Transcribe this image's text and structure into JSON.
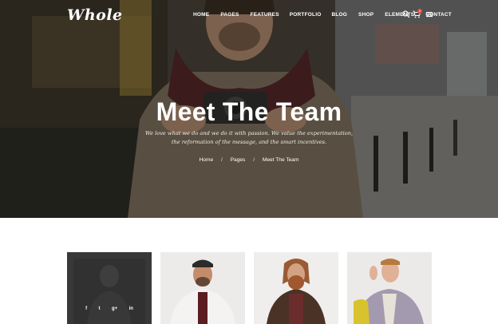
{
  "brand": {
    "logo_text": "Whole"
  },
  "nav": {
    "items": [
      "HOME",
      "PAGES",
      "FEATURES",
      "PORTFOLIO",
      "BLOG",
      "SHOP",
      "ELEMENTS",
      "CONTACT"
    ]
  },
  "header_icons": {
    "search": "search-icon",
    "cart": "cart-icon",
    "cart_count": "0",
    "menu": "hamburger-menu-icon"
  },
  "hero": {
    "title": "Meet The Team",
    "subtitle": "We love what we do and we do it with passion. We value the experimentation, the reformation of the message, and the smart incentives.",
    "breadcrumb": [
      "Home",
      "Pages",
      "Meet The Team"
    ],
    "breadcrumb_separator": "/"
  },
  "team": {
    "members": [
      {
        "photo": "team-member-1",
        "social": [
          "f",
          "t",
          "g+",
          "in"
        ]
      },
      {
        "photo": "team-member-2"
      },
      {
        "photo": "team-member-3"
      },
      {
        "photo": "team-member-4"
      }
    ]
  },
  "colors": {
    "accent": "#e44d3a",
    "hero_overlay": "#2a2622",
    "card_bg": "#ecebea"
  }
}
